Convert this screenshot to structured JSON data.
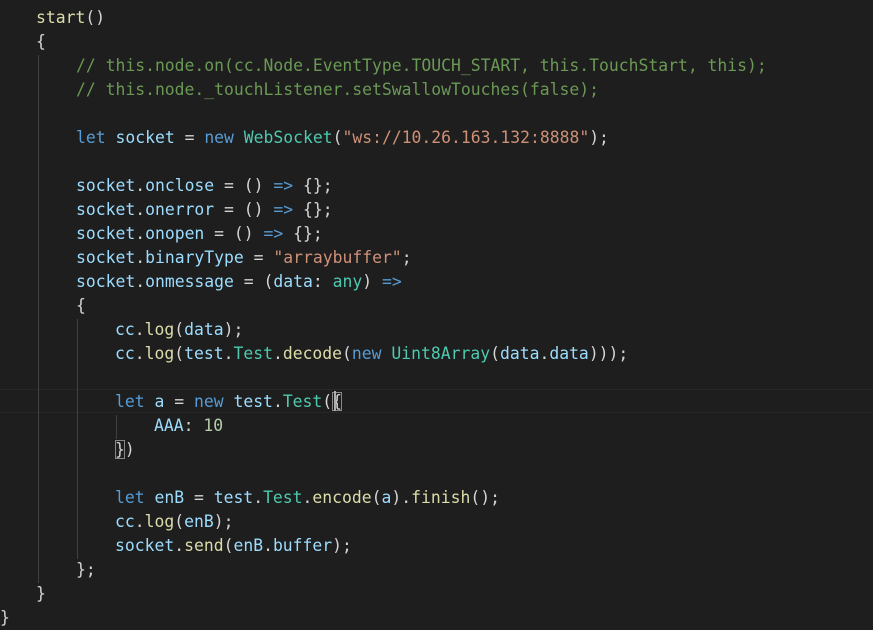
{
  "editor": {
    "theme": {
      "background": "#1e1e1e",
      "plain": "#d4d4d4",
      "keyword": "#569cd6",
      "comment": "#6a9955",
      "string": "#ce9178",
      "variable": "#9cdcfe",
      "function": "#dcdcaa",
      "type": "#4ec9b0",
      "number": "#b5cea8"
    },
    "lines": [
      [
        {
          "t": "start",
          "c": "function"
        },
        {
          "t": "()",
          "c": "plain"
        }
      ],
      [
        {
          "t": "{",
          "c": "plain"
        }
      ],
      [
        {
          "t": "// this.node.on(cc.Node.EventType.TOUCH_START, this.TouchStart, this);",
          "c": "comment"
        }
      ],
      [
        {
          "t": "// this.node._touchListener.setSwallowTouches(false);",
          "c": "comment"
        }
      ],
      [],
      [
        {
          "t": "let",
          "c": "keyword"
        },
        {
          "t": " ",
          "c": "plain"
        },
        {
          "t": "socket",
          "c": "variable"
        },
        {
          "t": " = ",
          "c": "plain"
        },
        {
          "t": "new",
          "c": "keyword"
        },
        {
          "t": " ",
          "c": "plain"
        },
        {
          "t": "WebSocket",
          "c": "type"
        },
        {
          "t": "(",
          "c": "plain"
        },
        {
          "t": "\"ws://10.26.163.132:8888\"",
          "c": "string"
        },
        {
          "t": ");",
          "c": "plain"
        }
      ],
      [],
      [
        {
          "t": "socket",
          "c": "variable"
        },
        {
          "t": ".",
          "c": "plain"
        },
        {
          "t": "onclose",
          "c": "variable"
        },
        {
          "t": " = () ",
          "c": "plain"
        },
        {
          "t": "=>",
          "c": "keyword"
        },
        {
          "t": " {};",
          "c": "plain"
        }
      ],
      [
        {
          "t": "socket",
          "c": "variable"
        },
        {
          "t": ".",
          "c": "plain"
        },
        {
          "t": "onerror",
          "c": "variable"
        },
        {
          "t": " = () ",
          "c": "plain"
        },
        {
          "t": "=>",
          "c": "keyword"
        },
        {
          "t": " {};",
          "c": "plain"
        }
      ],
      [
        {
          "t": "socket",
          "c": "variable"
        },
        {
          "t": ".",
          "c": "plain"
        },
        {
          "t": "onopen",
          "c": "variable"
        },
        {
          "t": " = () ",
          "c": "plain"
        },
        {
          "t": "=>",
          "c": "keyword"
        },
        {
          "t": " {};",
          "c": "plain"
        }
      ],
      [
        {
          "t": "socket",
          "c": "variable"
        },
        {
          "t": ".",
          "c": "plain"
        },
        {
          "t": "binaryType",
          "c": "variable"
        },
        {
          "t": " = ",
          "c": "plain"
        },
        {
          "t": "\"arraybuffer\"",
          "c": "string"
        },
        {
          "t": ";",
          "c": "plain"
        }
      ],
      [
        {
          "t": "socket",
          "c": "variable"
        },
        {
          "t": ".",
          "c": "plain"
        },
        {
          "t": "onmessage",
          "c": "variable"
        },
        {
          "t": " = (",
          "c": "plain"
        },
        {
          "t": "data",
          "c": "variable"
        },
        {
          "t": ": ",
          "c": "plain"
        },
        {
          "t": "any",
          "c": "type"
        },
        {
          "t": ") ",
          "c": "plain"
        },
        {
          "t": "=>",
          "c": "keyword"
        }
      ],
      [
        {
          "t": "{",
          "c": "plain"
        }
      ],
      [
        {
          "t": "cc",
          "c": "variable"
        },
        {
          "t": ".",
          "c": "plain"
        },
        {
          "t": "log",
          "c": "function"
        },
        {
          "t": "(",
          "c": "plain"
        },
        {
          "t": "data",
          "c": "variable"
        },
        {
          "t": ");",
          "c": "plain"
        }
      ],
      [
        {
          "t": "cc",
          "c": "variable"
        },
        {
          "t": ".",
          "c": "plain"
        },
        {
          "t": "log",
          "c": "function"
        },
        {
          "t": "(",
          "c": "plain"
        },
        {
          "t": "test",
          "c": "variable"
        },
        {
          "t": ".",
          "c": "plain"
        },
        {
          "t": "Test",
          "c": "type"
        },
        {
          "t": ".",
          "c": "plain"
        },
        {
          "t": "decode",
          "c": "function"
        },
        {
          "t": "(",
          "c": "plain"
        },
        {
          "t": "new",
          "c": "keyword"
        },
        {
          "t": " ",
          "c": "plain"
        },
        {
          "t": "Uint8Array",
          "c": "type"
        },
        {
          "t": "(",
          "c": "plain"
        },
        {
          "t": "data",
          "c": "variable"
        },
        {
          "t": ".",
          "c": "plain"
        },
        {
          "t": "data",
          "c": "variable"
        },
        {
          "t": ")));",
          "c": "plain"
        }
      ],
      [],
      [
        {
          "t": "let",
          "c": "keyword"
        },
        {
          "t": " ",
          "c": "plain"
        },
        {
          "t": "a",
          "c": "variable"
        },
        {
          "t": " = ",
          "c": "plain"
        },
        {
          "t": "new",
          "c": "keyword"
        },
        {
          "t": " ",
          "c": "plain"
        },
        {
          "t": "test",
          "c": "variable"
        },
        {
          "t": ".",
          "c": "plain"
        },
        {
          "t": "Test",
          "c": "type"
        },
        {
          "t": "(",
          "c": "plain"
        },
        {
          "t": "{",
          "c": "bracket-hl"
        }
      ],
      [
        {
          "t": "AAA",
          "c": "variable"
        },
        {
          "t": ": ",
          "c": "plain"
        },
        {
          "t": "10",
          "c": "number"
        }
      ],
      [
        {
          "t": "}",
          "c": "bracket-hl"
        },
        {
          "t": ")",
          "c": "plain"
        }
      ],
      [],
      [
        {
          "t": "let",
          "c": "keyword"
        },
        {
          "t": " ",
          "c": "plain"
        },
        {
          "t": "enB",
          "c": "variable"
        },
        {
          "t": " = ",
          "c": "plain"
        },
        {
          "t": "test",
          "c": "variable"
        },
        {
          "t": ".",
          "c": "plain"
        },
        {
          "t": "Test",
          "c": "type"
        },
        {
          "t": ".",
          "c": "plain"
        },
        {
          "t": "encode",
          "c": "function"
        },
        {
          "t": "(",
          "c": "plain"
        },
        {
          "t": "a",
          "c": "variable"
        },
        {
          "t": ").",
          "c": "plain"
        },
        {
          "t": "finish",
          "c": "function"
        },
        {
          "t": "();",
          "c": "plain"
        }
      ],
      [
        {
          "t": "cc",
          "c": "variable"
        },
        {
          "t": ".",
          "c": "plain"
        },
        {
          "t": "log",
          "c": "function"
        },
        {
          "t": "(",
          "c": "plain"
        },
        {
          "t": "enB",
          "c": "variable"
        },
        {
          "t": ");",
          "c": "plain"
        }
      ],
      [
        {
          "t": "socket",
          "c": "variable"
        },
        {
          "t": ".",
          "c": "plain"
        },
        {
          "t": "send",
          "c": "function"
        },
        {
          "t": "(",
          "c": "plain"
        },
        {
          "t": "enB",
          "c": "variable"
        },
        {
          "t": ".",
          "c": "plain"
        },
        {
          "t": "buffer",
          "c": "variable"
        },
        {
          "t": ");",
          "c": "plain"
        }
      ],
      [
        {
          "t": "};",
          "c": "plain"
        }
      ],
      [
        {
          "t": "}",
          "c": "plain"
        }
      ],
      [
        {
          "t": "}",
          "c": "plain"
        }
      ]
    ]
  }
}
